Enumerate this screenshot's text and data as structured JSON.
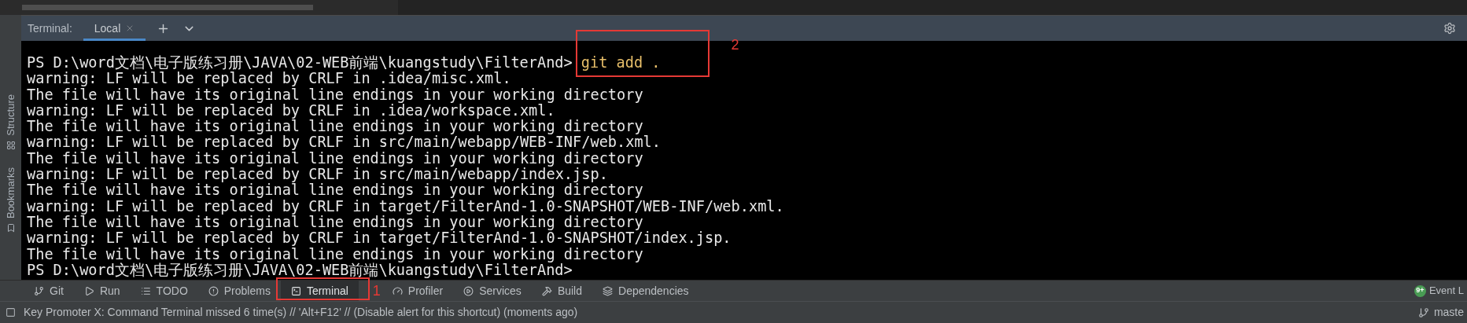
{
  "terminal": {
    "label": "Terminal:",
    "tabs": [
      {
        "label": "Local",
        "selected": true
      }
    ]
  },
  "sidebar": [
    {
      "label": "Structure"
    },
    {
      "label": "Bookmarks"
    }
  ],
  "lines": [
    {
      "kind": "prompt",
      "prompt": "PS D:\\word文档\\电子版练习册\\JAVA\\02-WEB前端\\kuangstudy\\FilterAnd>",
      "command": "git add .",
      "annotation": "2"
    },
    {
      "kind": "output",
      "text": "warning: LF will be replaced by CRLF in .idea/misc.xml."
    },
    {
      "kind": "output",
      "text": "The file will have its original line endings in your working directory"
    },
    {
      "kind": "output",
      "text": "warning: LF will be replaced by CRLF in .idea/workspace.xml."
    },
    {
      "kind": "output",
      "text": "The file will have its original line endings in your working directory"
    },
    {
      "kind": "output",
      "text": "warning: LF will be replaced by CRLF in src/main/webapp/WEB-INF/web.xml."
    },
    {
      "kind": "output",
      "text": "The file will have its original line endings in your working directory"
    },
    {
      "kind": "output",
      "text": "warning: LF will be replaced by CRLF in src/main/webapp/index.jsp."
    },
    {
      "kind": "output",
      "text": "The file will have its original line endings in your working directory"
    },
    {
      "kind": "output",
      "text": "warning: LF will be replaced by CRLF in target/FilterAnd-1.0-SNAPSHOT/WEB-INF/web.xml."
    },
    {
      "kind": "output",
      "text": "The file will have its original line endings in your working directory"
    },
    {
      "kind": "output",
      "text": "warning: LF will be replaced by CRLF in target/FilterAnd-1.0-SNAPSHOT/index.jsp."
    },
    {
      "kind": "output",
      "text": "The file will have its original line endings in your working directory"
    },
    {
      "kind": "prompt",
      "prompt": "PS D:\\word文档\\电子版练习册\\JAVA\\02-WEB前端\\kuangstudy\\FilterAnd>"
    }
  ],
  "tool_windows": [
    {
      "label": "Git",
      "selected": false
    },
    {
      "label": "Run",
      "selected": false
    },
    {
      "label": "TODO",
      "selected": false
    },
    {
      "label": "Problems",
      "selected": false
    },
    {
      "label": "Terminal",
      "selected": true,
      "annotation": "1"
    },
    {
      "label": "Profiler",
      "selected": false
    },
    {
      "label": "Services",
      "selected": false
    },
    {
      "label": "Build",
      "selected": false
    },
    {
      "label": "Dependencies",
      "selected": false
    }
  ],
  "event_log": {
    "badge": "9+",
    "label": "Event L"
  },
  "status_bar": {
    "message": "Key Promoter X: Command Terminal missed 6 time(s) // 'Alt+F12' // (Disable alert for this shortcut) (moments ago)",
    "branch": "maste"
  }
}
